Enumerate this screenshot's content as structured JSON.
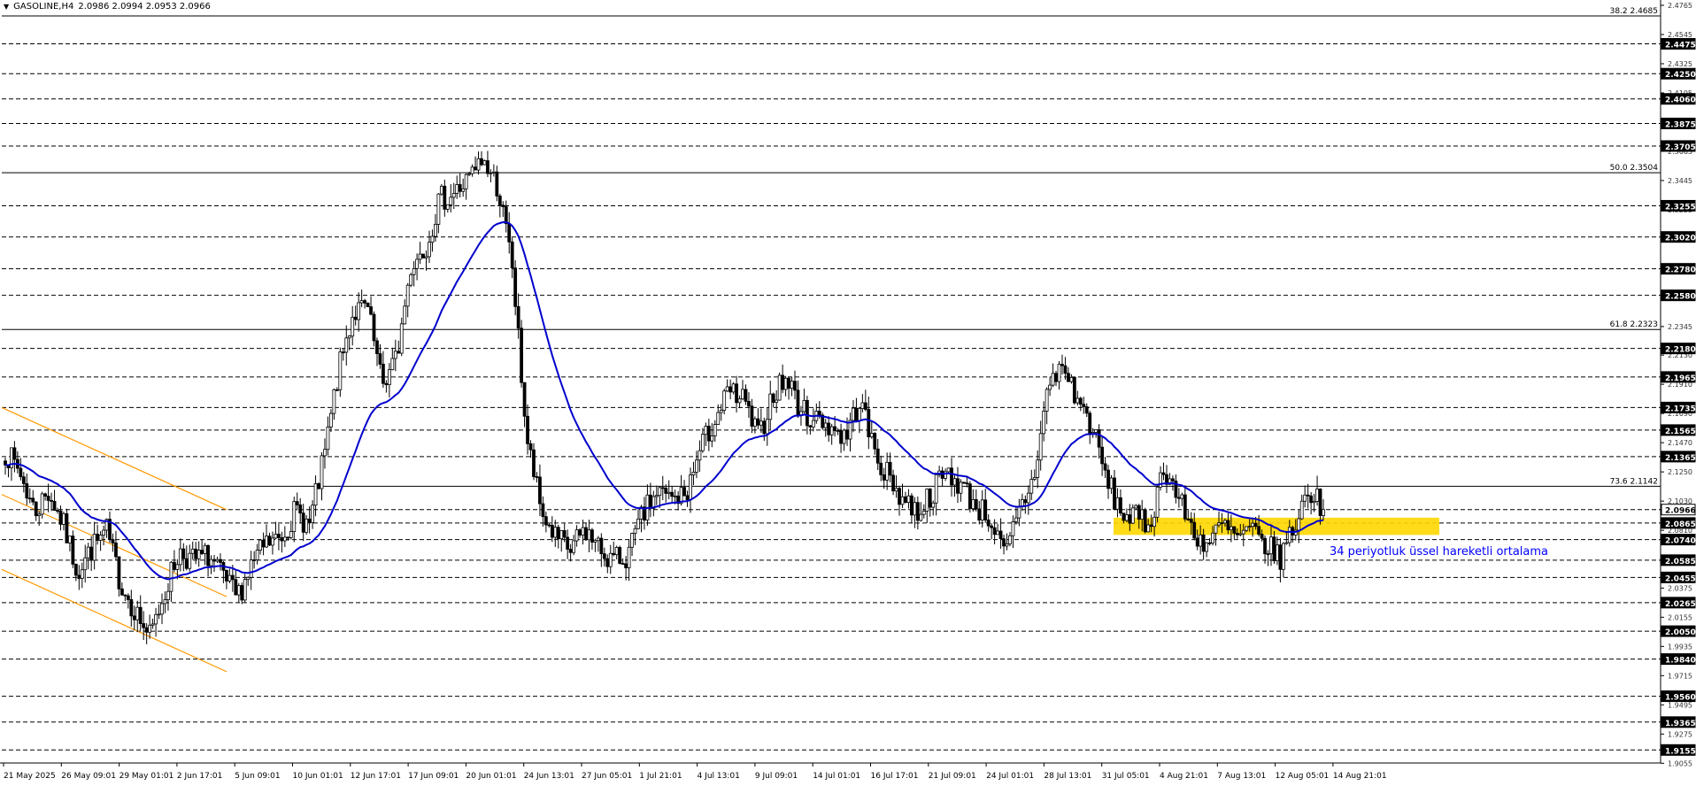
{
  "header": {
    "symbol": "GASOLINE,H4",
    "quote": "2.0986 2.0994 2.0953 2.0966",
    "menu_icon": "triangle-down-icon"
  },
  "colors": {
    "background": "#ffffff",
    "candle": "#000000",
    "ema": "#0000cd",
    "channel": "#ff9900",
    "zone": "#ffd700",
    "annotation": "#0000ff",
    "grid": "#000000",
    "price_box": "#000000"
  },
  "annotation": "34 periyotluk üssel hareketli ortalama",
  "chart_data": {
    "type": "candlestick",
    "ylim": [
      1.9057,
      2.4765
    ],
    "axis_scale": [
      "2.4765",
      "2.4545",
      "2.4325",
      "2.4105",
      "2.3885",
      "2.3665",
      "2.3445",
      "2.3225",
      "2.3005",
      "2.2785",
      "2.2565",
      "2.2345",
      "2.2130",
      "2.1910",
      "2.1690",
      "2.1470",
      "2.1250",
      "2.1030",
      "2.0810",
      "2.0590",
      "2.0375",
      "2.0155",
      "1.9935",
      "1.9715",
      "1.9495",
      "1.9275",
      "1.9055"
    ],
    "price_levels": [
      "2.4475",
      "2.4250",
      "2.4060",
      "2.3875",
      "2.3705",
      "2.3255",
      "2.3020",
      "2.2780",
      "2.2580",
      "2.2180",
      "2.1965",
      "2.1735",
      "2.1565",
      "2.1365",
      "2.0966",
      "2.0865",
      "2.0740",
      "2.0585",
      "2.0455",
      "2.0265",
      "2.0050",
      "1.9840",
      "1.9560",
      "1.9365",
      "1.9155"
    ],
    "current_price": "2.0966",
    "fib_levels": [
      {
        "label": "38.2 2.4685",
        "value": 2.4685
      },
      {
        "label": "50.0 2.3504",
        "value": 2.3504
      },
      {
        "label": "61.8 2.2323",
        "value": 2.2323
      },
      {
        "label": "73.6 2.1142",
        "value": 2.1142
      }
    ],
    "x_labels": [
      "21 May 2025",
      "26 May 09:01",
      "29 May 01:01",
      "2 Jun 17:01",
      "5 Jun 09:01",
      "10 Jun 01:01",
      "12 Jun 17:01",
      "17 Jun 09:01",
      "20 Jun 01:01",
      "24 Jun 13:01",
      "27 Jun 05:01",
      "1 Jul 21:01",
      "4 Jul 13:01",
      "9 Jul 09:01",
      "14 Jul 01:01",
      "16 Jul 17:01",
      "21 Jul 09:01",
      "24 Jul 01:01",
      "28 Jul 13:01",
      "31 Jul 05:01",
      "4 Aug 21:01",
      "7 Aug 13:01",
      "12 Aug 05:01",
      "14 Aug 21:01"
    ],
    "price_path": [
      2.14,
      2.125,
      2.095,
      2.11,
      2.085,
      2.05,
      2.068,
      2.08,
      2.04,
      2.02,
      2.0,
      2.035,
      2.065,
      2.058,
      2.062,
      2.045,
      2.03,
      2.055,
      2.07,
      2.075,
      2.095,
      2.085,
      2.135,
      2.2,
      2.245,
      2.248,
      2.19,
      2.21,
      2.28,
      2.295,
      2.33,
      2.335,
      2.345,
      2.36,
      2.34,
      2.28,
      2.15,
      2.095,
      2.075,
      2.065,
      2.082,
      2.067,
      2.058,
      2.062,
      2.092,
      2.11,
      2.104,
      2.108,
      2.142,
      2.165,
      2.185,
      2.178,
      2.15,
      2.185,
      2.195,
      2.17,
      2.165,
      2.16,
      2.15,
      2.18,
      2.14,
      2.12,
      2.105,
      2.095,
      2.11,
      2.125,
      2.115,
      2.1,
      2.09,
      2.06,
      2.095,
      2.12,
      2.19,
      2.205,
      2.18,
      2.16,
      2.12,
      2.095,
      2.09,
      2.085,
      2.13,
      2.105,
      2.08,
      2.07,
      2.085,
      2.075,
      2.08,
      2.07,
      2.06,
      2.085,
      2.112,
      2.097
    ]
  }
}
